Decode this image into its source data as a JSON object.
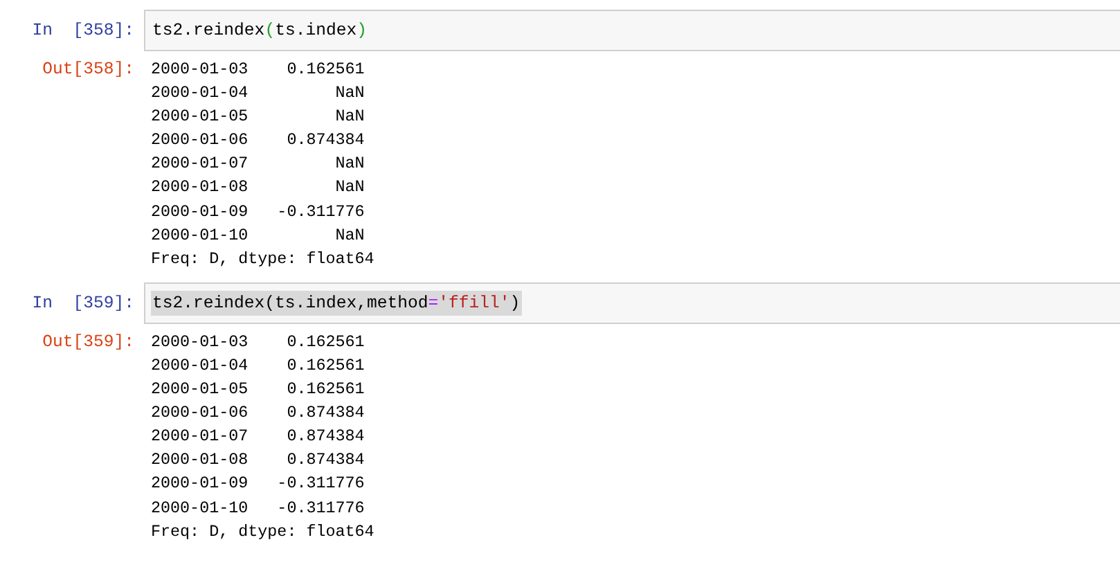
{
  "cells": [
    {
      "prompt": "In  [358]:",
      "text_selected": false,
      "code": [
        {
          "kind": "plain",
          "text": "ts2.reindex"
        },
        {
          "kind": "paren",
          "text": "("
        },
        {
          "kind": "plain",
          "text": "ts.index"
        },
        {
          "kind": "paren",
          "text": ")"
        }
      ],
      "out_prompt": "Out[358]:",
      "output": [
        "2000-01-03    0.162561",
        "2000-01-04         NaN",
        "2000-01-05         NaN",
        "2000-01-06    0.874384",
        "2000-01-07         NaN",
        "2000-01-08         NaN",
        "2000-01-09   -0.311776",
        "2000-01-10         NaN",
        "Freq: D, dtype: float64"
      ]
    },
    {
      "prompt": "In  [359]:",
      "text_selected": true,
      "code": [
        {
          "kind": "plain",
          "text": "ts2.reindex(ts.index,method"
        },
        {
          "kind": "operator",
          "text": "="
        },
        {
          "kind": "string",
          "text": "'ffill'"
        },
        {
          "kind": "plain",
          "text": ")"
        }
      ],
      "out_prompt": "Out[359]:",
      "output": [
        "2000-01-03    0.162561",
        "2000-01-04    0.162561",
        "2000-01-05    0.162561",
        "2000-01-06    0.874384",
        "2000-01-07    0.874384",
        "2000-01-08    0.874384",
        "2000-01-09   -0.311776",
        "2000-01-10   -0.311776",
        "Freq: D, dtype: float64"
      ]
    }
  ]
}
